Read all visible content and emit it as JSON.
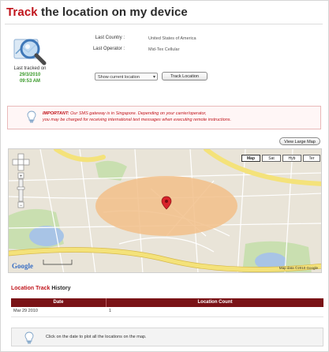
{
  "page": {
    "title_accent": "Track",
    "title_rest": " the location on my device"
  },
  "device": {
    "icon": "magnifier-map-icon",
    "tracked_label": "Last tracked on",
    "tracked_date": "29/3/2010",
    "tracked_time": "09:53 AM"
  },
  "info": {
    "country_label": "Last Country :",
    "country_value": "United States of America",
    "operator_label": "Last Operator :",
    "operator_value": "Mid-Tex Cellular"
  },
  "controls": {
    "location_select_value": "Show current location",
    "track_button": "Track Location"
  },
  "important": {
    "icon": "lightbulb-icon",
    "label": "IMPORTANT:",
    "line1_rest": " Our SMS gateway is in Singapore. Depending on your carrier/operator,",
    "line2": "you may be charged for receiving international text messages when executing remote instructions."
  },
  "map": {
    "view_large_button": "View Large Map",
    "types": [
      "Map",
      "Sat",
      "Hyb",
      "Ter"
    ],
    "active_type": "Map",
    "google_logo": "Google",
    "attribution": "Map data ©2010 Google",
    "colors": {
      "land": "#e9e4d8",
      "highway": "#f4e27a",
      "water": "#a8c4e6",
      "park": "#c9dfb0",
      "accuracy_circle": "#f2c08a",
      "marker": "#d8232a"
    }
  },
  "history": {
    "title_accent": "Location Track",
    "title_rest": " History",
    "columns": [
      "Date",
      "Location Count"
    ],
    "rows": [
      {
        "date": "Mar 29 2010",
        "count": "1"
      }
    ]
  },
  "footer": {
    "icon": "lightbulb-icon",
    "text": "Click on the date to plot all the locations on the map."
  }
}
